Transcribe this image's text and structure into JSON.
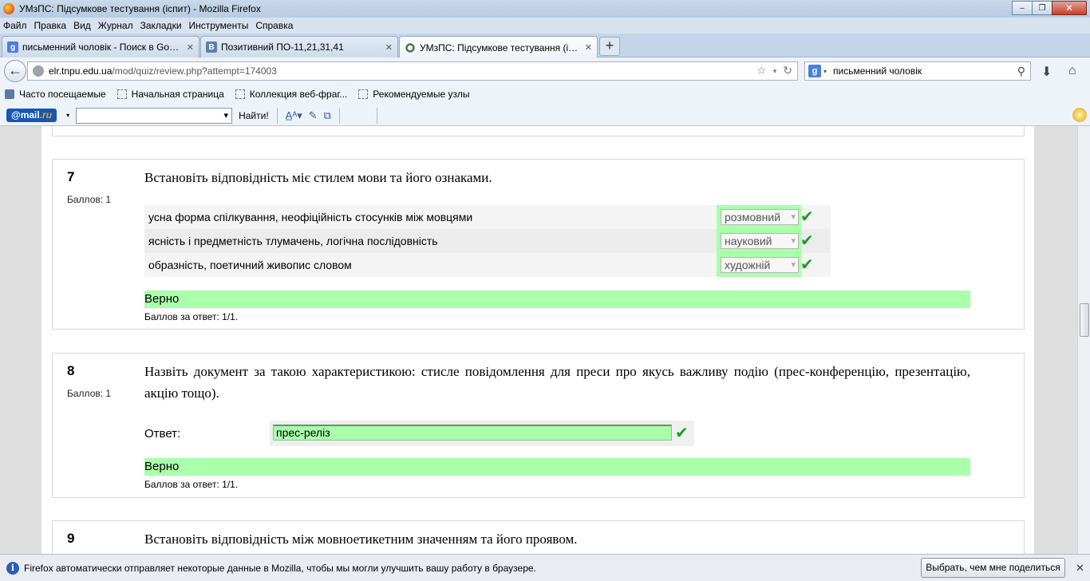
{
  "window": {
    "title": "УМзПС: Підсумкове тестування (іспит) - Mozilla Firefox",
    "minimize": "–",
    "maximize": "❐",
    "close": "✕"
  },
  "menu": [
    "Файл",
    "Правка",
    "Вид",
    "Журнал",
    "Закладки",
    "Инструменты",
    "Справка"
  ],
  "tabs": [
    {
      "title": "письменний чоловік - Поиск в Goo...",
      "favicon": "g"
    },
    {
      "title": "Позитивний ПО-11,21,31,41",
      "favicon": "B"
    },
    {
      "title": "УМзПС: Підсумкове тестування (ісп...",
      "favicon": ""
    }
  ],
  "new_tab": "+",
  "nav": {
    "url_domain": "elr.tnpu.edu.ua",
    "url_path": "/mod/quiz/review.php?attempt=174003",
    "search_text": "письменний чоловік",
    "search_engine": "g"
  },
  "bookmarks": [
    "Часто посещаемые",
    "Начальная страница",
    "Коллекция веб-фраг...",
    "Рекомендуемые узлы"
  ],
  "mailbar": {
    "logo_prefix": "@mail",
    "logo_suffix": ".ru",
    "find_label": "Найти!"
  },
  "questions": [
    {
      "number": "7",
      "grade": "Баллов: 1",
      "text": "Встановіть відповідність міє стилем мови та його ознаками.",
      "rows": [
        {
          "text": "усна форма спілкування, неофіційність стосунків між мовцями",
          "answer": "розмовний"
        },
        {
          "text": "ясність і предметність тлумачень, логічна послідовність",
          "answer": "науковий"
        },
        {
          "text": "образність, поетичний живопис словом",
          "answer": "художній"
        }
      ],
      "outcome": "Верно",
      "mark": "Баллов за ответ: 1/1."
    },
    {
      "number": "8",
      "grade": "Баллов: 1",
      "text": "Назвіть документ за такою характеристикою: стисле повідомлення для преси про якусь важливу подію (прес-конференцію, презентацію, акцію тощо).",
      "answer_label": "Ответ:",
      "answer": "прес-реліз",
      "outcome": "Верно",
      "mark": "Баллов за ответ: 1/1."
    },
    {
      "number": "9",
      "text": "Встановіть відповідність між мовноетикетним значенням та його проявом."
    }
  ],
  "notification": {
    "text": "Firefox автоматически отправляет некоторые данные в Mozilla, чтобы мы могли улучшить вашу работу в браузере.",
    "button": "Выбрать, чем мне поделиться",
    "close": "✕"
  },
  "colors": {
    "correct": "#aaffaa",
    "tick": "#1f9c27"
  }
}
